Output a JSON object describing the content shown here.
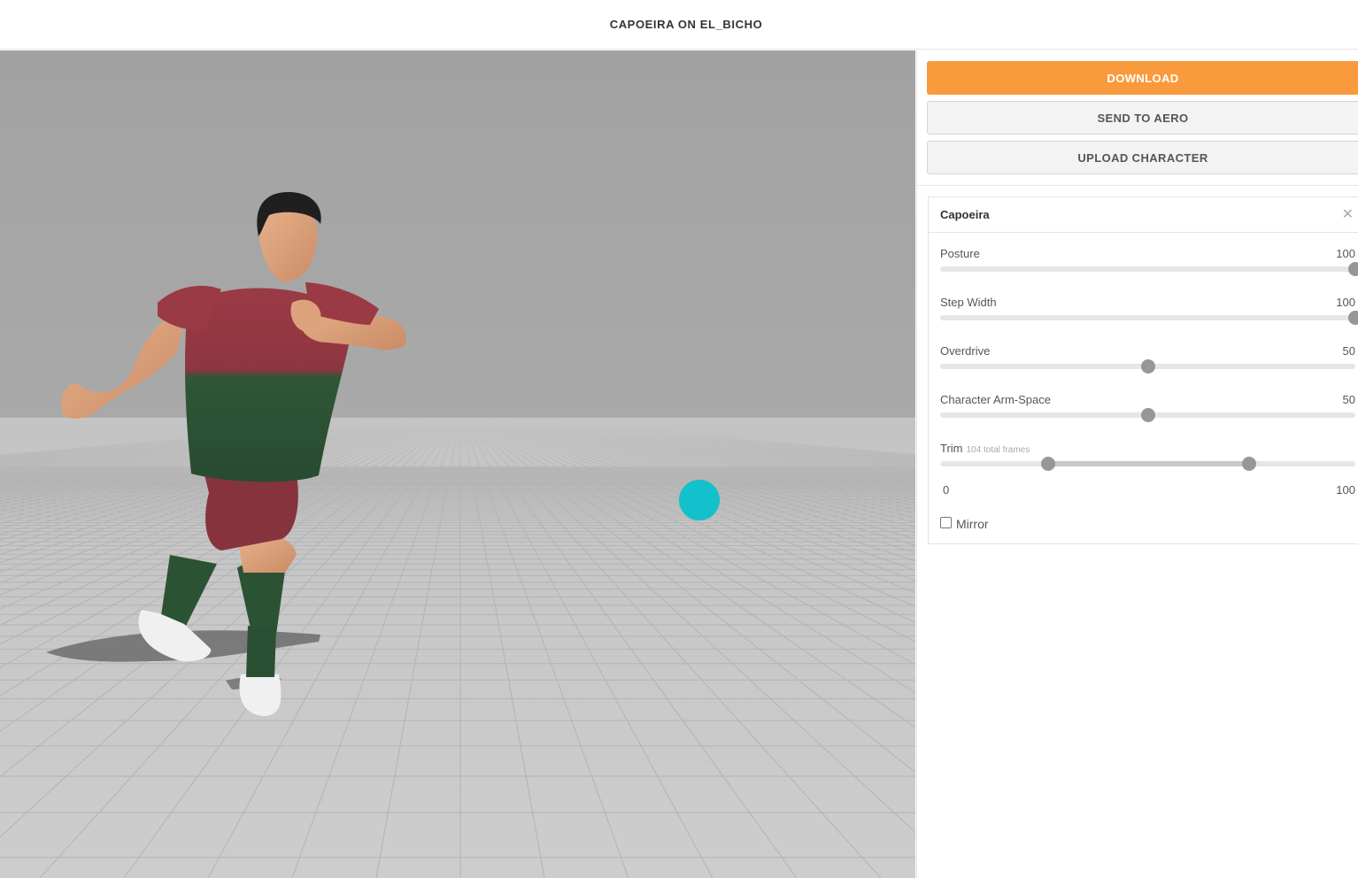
{
  "header": {
    "title": "CAPOEIRA ON EL_BICHO"
  },
  "actions": {
    "download_label": "DOWNLOAD",
    "send_label": "SEND TO AERO",
    "upload_label": "UPLOAD CHARACTER"
  },
  "colors": {
    "accent": "#f99a3d",
    "marker": "#13c1cc"
  },
  "panel": {
    "title": "Capoeira",
    "close_icon": "close-icon",
    "sliders": [
      {
        "label": "Posture",
        "value": "100",
        "fraction": 1.0
      },
      {
        "label": "Step Width",
        "value": "100",
        "fraction": 1.0
      },
      {
        "label": "Overdrive",
        "value": "50",
        "fraction": 0.5
      },
      {
        "label": "Character Arm-Space",
        "value": "50",
        "fraction": 0.5
      }
    ],
    "trim": {
      "label": "Trim",
      "sublabel": "104 total frames",
      "min_label": "0",
      "max_label": "100",
      "start_fraction": 0.26,
      "end_fraction": 0.745
    },
    "mirror": {
      "label": "Mirror",
      "checked": false
    }
  }
}
